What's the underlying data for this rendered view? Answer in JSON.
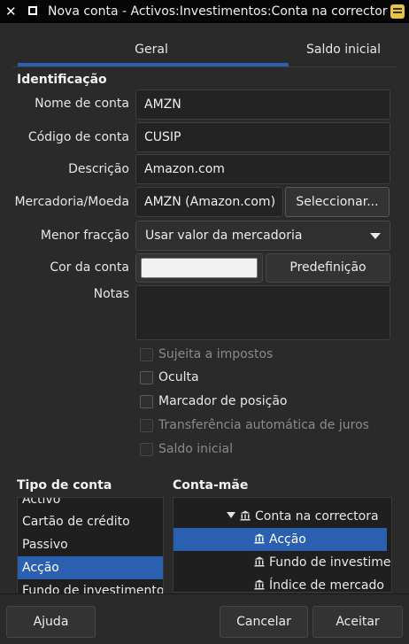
{
  "window": {
    "title": "Nova conta - Activos:Investimentos:Conta na correctora:Acção"
  },
  "tabs": {
    "geral": "Geral",
    "saldo_inicial": "Saldo inicial"
  },
  "identificacao": {
    "header": "Identificação",
    "nome_label": "Nome de conta",
    "nome_value": "AMZN",
    "codigo_label": "Código de conta",
    "codigo_value": "CUSIP",
    "descricao_label": "Descrição",
    "descricao_value": "Amazon.com",
    "mercadoria_label": "Mercadoria/Moeda",
    "mercadoria_value": "AMZN (Amazon.com)",
    "seleccionar_button": "Seleccionar...",
    "fraccao_label": "Menor fracção",
    "fraccao_value": "Usar valor da mercadoria",
    "cor_label": "Cor da conta",
    "cor_swatch": "#f2f2f2",
    "predefinicao_button": "Predefinição",
    "notas_label": "Notas"
  },
  "checkboxes": {
    "sujeita": "Sujeita a impostos",
    "oculta": "Oculta",
    "marcador": "Marcador de posição",
    "transferencia": "Transferência automática de juros",
    "saldo": "Saldo inicial"
  },
  "tipo_conta": {
    "header": "Tipo de conta",
    "items": [
      "Activo",
      "Cartão de crédito",
      "Passivo",
      "Acção",
      "Fundo de investimento"
    ]
  },
  "conta_mae": {
    "header": "Conta-mãe",
    "parent": "Conta na correctora",
    "children": [
      "Acção",
      "Fundo de investime",
      "Índice de mercado"
    ]
  },
  "buttons": {
    "ajuda": "Ajuda",
    "cancelar": "Cancelar",
    "aceitar": "Aceitar"
  },
  "colors": {
    "accent": "#2b5fb0",
    "background": "#2a2a2a"
  }
}
